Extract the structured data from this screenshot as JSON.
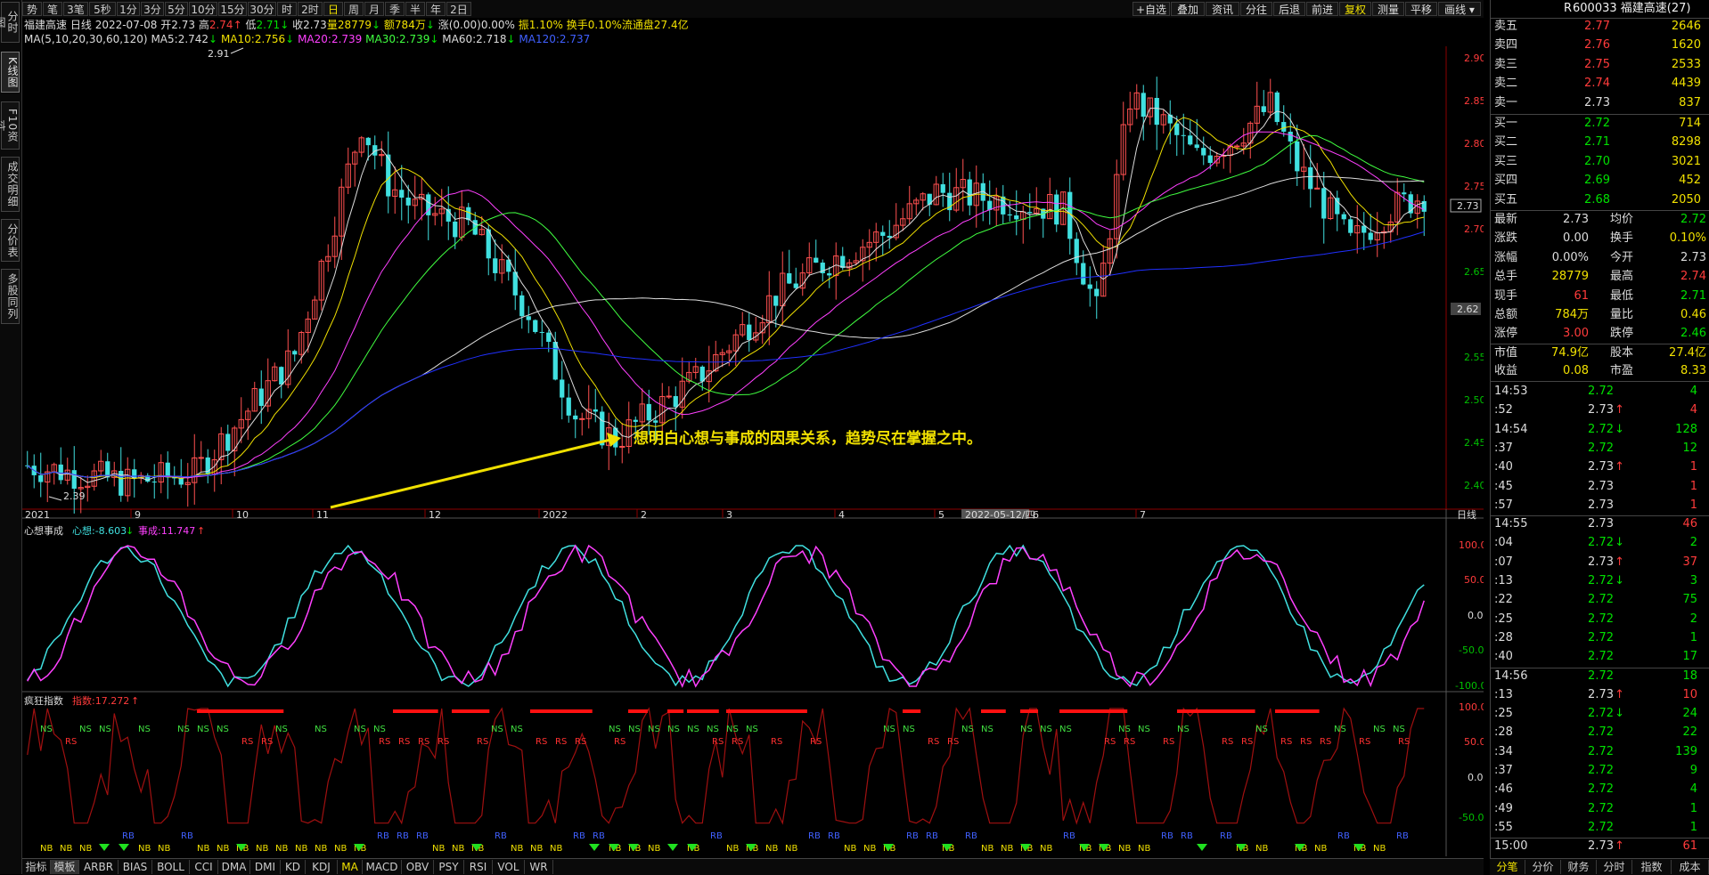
{
  "left_tabs": [
    "分时图",
    "K线图",
    "F10资料",
    "成交明细",
    "分价表",
    "多股同列"
  ],
  "left_tab_active": 1,
  "toolbar": {
    "periods": [
      "势",
      "笔",
      "3笔",
      "5秒",
      "1分",
      "3分",
      "5分",
      "10分",
      "15分",
      "30分",
      "时",
      "2时",
      "日",
      "周",
      "月",
      "季",
      "半",
      "年",
      "2日"
    ],
    "active_period": 12,
    "actions": [
      "+自选",
      "叠加",
      "资讯",
      "分往",
      "后退",
      "前进",
      "复权",
      "测量",
      "平移",
      "画线"
    ],
    "active_action": 6
  },
  "stock": {
    "name": "福建高速",
    "period_label": "日线",
    "date": "2022-07-08",
    "open_label": "开",
    "open": "2.73",
    "high_label": "高",
    "high": "2.74",
    "low_label": "低",
    "low": "2.71",
    "close_label": "收",
    "close": "2.73",
    "vol_label": "量",
    "vol": "28779",
    "amt_label": "额",
    "amt": "784万",
    "chg_label": "涨",
    "chg": "(0.00)0.00%",
    "amp_label": "振",
    "amp": "1.10%",
    "turn_label": "换手",
    "turn": "0.10%",
    "float_label": "流通盘",
    "float": "27.4亿"
  },
  "ma_line": {
    "label": "MA(5,10,20,30,60,120)",
    "items": [
      {
        "text": "MA5:2.742",
        "color": "#dcdcdc"
      },
      {
        "text": "MA10:2.756",
        "color": "#f0e000"
      },
      {
        "text": "MA20:2.739",
        "color": "#ff40ff"
      },
      {
        "text": "MA30:2.739",
        "color": "#40ff40"
      },
      {
        "text": "MA60:2.718",
        "color": "#dcdcdc"
      },
      {
        "text": "MA120:2.737",
        "color": "#4060ff"
      }
    ]
  },
  "main_chart": {
    "y_ticks": [
      "2.90",
      "2.85",
      "2.80",
      "2.75",
      "2.70",
      "2.65",
      "2.60",
      "2.55",
      "2.50",
      "2.45",
      "2.40"
    ],
    "price_marker": "2.73",
    "cursor_marker": "2.62",
    "peak_label": "2.91",
    "trough_label": "2.39",
    "x_labels": [
      "2021",
      "9",
      "10",
      "11",
      "12",
      "2022",
      "2",
      "3",
      "4",
      "5",
      "6",
      "7"
    ],
    "x_date_highlight": "2022-05-12/四",
    "x_right_label": "日线",
    "annotation": "想明白心想与事成的因果关系，趋势尽在掌握之中。"
  },
  "indicator1": {
    "title": "心想事成",
    "xin_label": "心想:-8.603",
    "shi_label": "事成:11.747",
    "y_ticks": [
      "100.00",
      "50.00",
      "0.00",
      "-50.00",
      "-100.00"
    ]
  },
  "indicator2": {
    "title": "疯狂指数",
    "sub_label": "指数:17.272",
    "y_ticks": [
      "100.00",
      "50.00",
      "0.00",
      "-50.00"
    ],
    "ns_label": "NS",
    "rs_label": "RS",
    "nb_label": "NB",
    "rb_label": "RB"
  },
  "bottom_tabs": [
    "指标",
    "模板",
    "ARBR",
    "BIAS",
    "BOLL",
    "CCI",
    "DMA",
    "DMI",
    "KD",
    "KDJ",
    "MA",
    "MACD",
    "OBV",
    "PSY",
    "RSI",
    "VOL",
    "WR"
  ],
  "bottom_tab_active": 10,
  "right_panel": {
    "code_title": "600033 福建高速(27)",
    "asks": [
      {
        "label": "卖五",
        "price": "2.77",
        "vol": "2646",
        "color": "#ff3b3b"
      },
      {
        "label": "卖四",
        "price": "2.76",
        "vol": "1620",
        "color": "#ff3b3b"
      },
      {
        "label": "卖三",
        "price": "2.75",
        "vol": "2533",
        "color": "#ff3b3b"
      },
      {
        "label": "卖二",
        "price": "2.74",
        "vol": "4439",
        "color": "#ff3b3b"
      },
      {
        "label": "卖一",
        "price": "2.73",
        "vol": "837",
        "color": "#dcdcdc"
      }
    ],
    "bids": [
      {
        "label": "买一",
        "price": "2.72",
        "vol": "714",
        "color": "#00e000"
      },
      {
        "label": "买二",
        "price": "2.71",
        "vol": "8298",
        "color": "#00e000"
      },
      {
        "label": "买三",
        "price": "2.70",
        "vol": "3021",
        "color": "#00e000"
      },
      {
        "label": "买四",
        "price": "2.69",
        "vol": "452",
        "color": "#00e000"
      },
      {
        "label": "买五",
        "price": "2.68",
        "vol": "2050",
        "color": "#00e000"
      }
    ],
    "stats": [
      {
        "l1": "最新",
        "v1": "2.73",
        "c1": "#dcdcdc",
        "l2": "均价",
        "v2": "2.72",
        "c2": "#00e000"
      },
      {
        "l1": "涨跌",
        "v1": "0.00",
        "c1": "#dcdcdc",
        "l2": "换手",
        "v2": "0.10%",
        "c2": "#f0e000"
      },
      {
        "l1": "涨幅",
        "v1": "0.00%",
        "c1": "#dcdcdc",
        "l2": "今开",
        "v2": "2.73",
        "c2": "#dcdcdc"
      },
      {
        "l1": "总手",
        "v1": "28779",
        "c1": "#f0e000",
        "l2": "最高",
        "v2": "2.74",
        "c2": "#ff3b3b"
      },
      {
        "l1": "现手",
        "v1": "61",
        "c1": "#ff3b3b",
        "l2": "最低",
        "v2": "2.71",
        "c2": "#00e000"
      },
      {
        "l1": "总额",
        "v1": "784万",
        "c1": "#f0e000",
        "l2": "量比",
        "v2": "0.46",
        "c2": "#f0e000"
      },
      {
        "l1": "涨停",
        "v1": "3.00",
        "c1": "#ff3b3b",
        "l2": "跌停",
        "v2": "2.46",
        "c2": "#00e000"
      }
    ],
    "fund": [
      {
        "l1": "市值",
        "v1": "74.9亿",
        "l2": "股本",
        "v2": "27.4亿"
      },
      {
        "l1": "收益",
        "v1": "0.08",
        "l2": "市盈",
        "v2": "8.33"
      }
    ],
    "ticks": [
      {
        "t": "14:53",
        "p": "2.72",
        "v": "4",
        "pc": "#00e000",
        "vc": "#00e000",
        "arrow": ""
      },
      {
        "t": ":52",
        "p": "2.73",
        "v": "4",
        "pc": "#dcdcdc",
        "vc": "#ff3b3b",
        "arrow": "↑"
      },
      {
        "t": "14:54",
        "p": "2.72",
        "v": "128",
        "pc": "#00e000",
        "vc": "#00e000",
        "arrow": "↓"
      },
      {
        "t": ":37",
        "p": "2.72",
        "v": "12",
        "pc": "#00e000",
        "vc": "#00e000",
        "arrow": ""
      },
      {
        "t": ":40",
        "p": "2.73",
        "v": "1",
        "pc": "#dcdcdc",
        "vc": "#ff3b3b",
        "arrow": "↑"
      },
      {
        "t": ":45",
        "p": "2.73",
        "v": "1",
        "pc": "#dcdcdc",
        "vc": "#ff3b3b",
        "arrow": ""
      },
      {
        "t": ":57",
        "p": "2.73",
        "v": "1",
        "pc": "#dcdcdc",
        "vc": "#ff3b3b",
        "arrow": ""
      },
      {
        "t": "14:55",
        "p": "2.73",
        "v": "46",
        "pc": "#dcdcdc",
        "vc": "#ff3b3b",
        "arrow": ""
      },
      {
        "t": ":04",
        "p": "2.72",
        "v": "2",
        "pc": "#00e000",
        "vc": "#00e000",
        "arrow": "↓"
      },
      {
        "t": ":07",
        "p": "2.73",
        "v": "37",
        "pc": "#dcdcdc",
        "vc": "#ff3b3b",
        "arrow": "↑"
      },
      {
        "t": ":13",
        "p": "2.72",
        "v": "3",
        "pc": "#00e000",
        "vc": "#00e000",
        "arrow": "↓"
      },
      {
        "t": ":22",
        "p": "2.72",
        "v": "75",
        "pc": "#00e000",
        "vc": "#00e000",
        "arrow": ""
      },
      {
        "t": ":25",
        "p": "2.72",
        "v": "2",
        "pc": "#00e000",
        "vc": "#00e000",
        "arrow": ""
      },
      {
        "t": ":28",
        "p": "2.72",
        "v": "1",
        "pc": "#00e000",
        "vc": "#00e000",
        "arrow": ""
      },
      {
        "t": ":40",
        "p": "2.72",
        "v": "17",
        "pc": "#00e000",
        "vc": "#00e000",
        "arrow": ""
      },
      {
        "t": "14:56",
        "p": "2.72",
        "v": "18",
        "pc": "#00e000",
        "vc": "#00e000",
        "arrow": ""
      },
      {
        "t": ":13",
        "p": "2.73",
        "v": "10",
        "pc": "#dcdcdc",
        "vc": "#ff3b3b",
        "arrow": "↑"
      },
      {
        "t": ":25",
        "p": "2.72",
        "v": "24",
        "pc": "#00e000",
        "vc": "#00e000",
        "arrow": "↓"
      },
      {
        "t": ":28",
        "p": "2.72",
        "v": "22",
        "pc": "#00e000",
        "vc": "#00e000",
        "arrow": ""
      },
      {
        "t": ":34",
        "p": "2.72",
        "v": "139",
        "pc": "#00e000",
        "vc": "#00e000",
        "arrow": ""
      },
      {
        "t": ":37",
        "p": "2.72",
        "v": "9",
        "pc": "#00e000",
        "vc": "#00e000",
        "arrow": ""
      },
      {
        "t": ":46",
        "p": "2.72",
        "v": "4",
        "pc": "#00e000",
        "vc": "#00e000",
        "arrow": ""
      },
      {
        "t": ":49",
        "p": "2.72",
        "v": "1",
        "pc": "#00e000",
        "vc": "#00e000",
        "arrow": ""
      },
      {
        "t": ":55",
        "p": "2.72",
        "v": "1",
        "pc": "#00e000",
        "vc": "#00e000",
        "arrow": ""
      },
      {
        "t": "15:00",
        "p": "2.73",
        "v": "61",
        "pc": "#dcdcdc",
        "vc": "#ff3b3b",
        "arrow": "↑"
      }
    ],
    "bottom_tabs": [
      "分笔",
      "分价",
      "财务",
      "分时",
      "指数",
      "成本"
    ],
    "bottom_tab_active": 0
  }
}
